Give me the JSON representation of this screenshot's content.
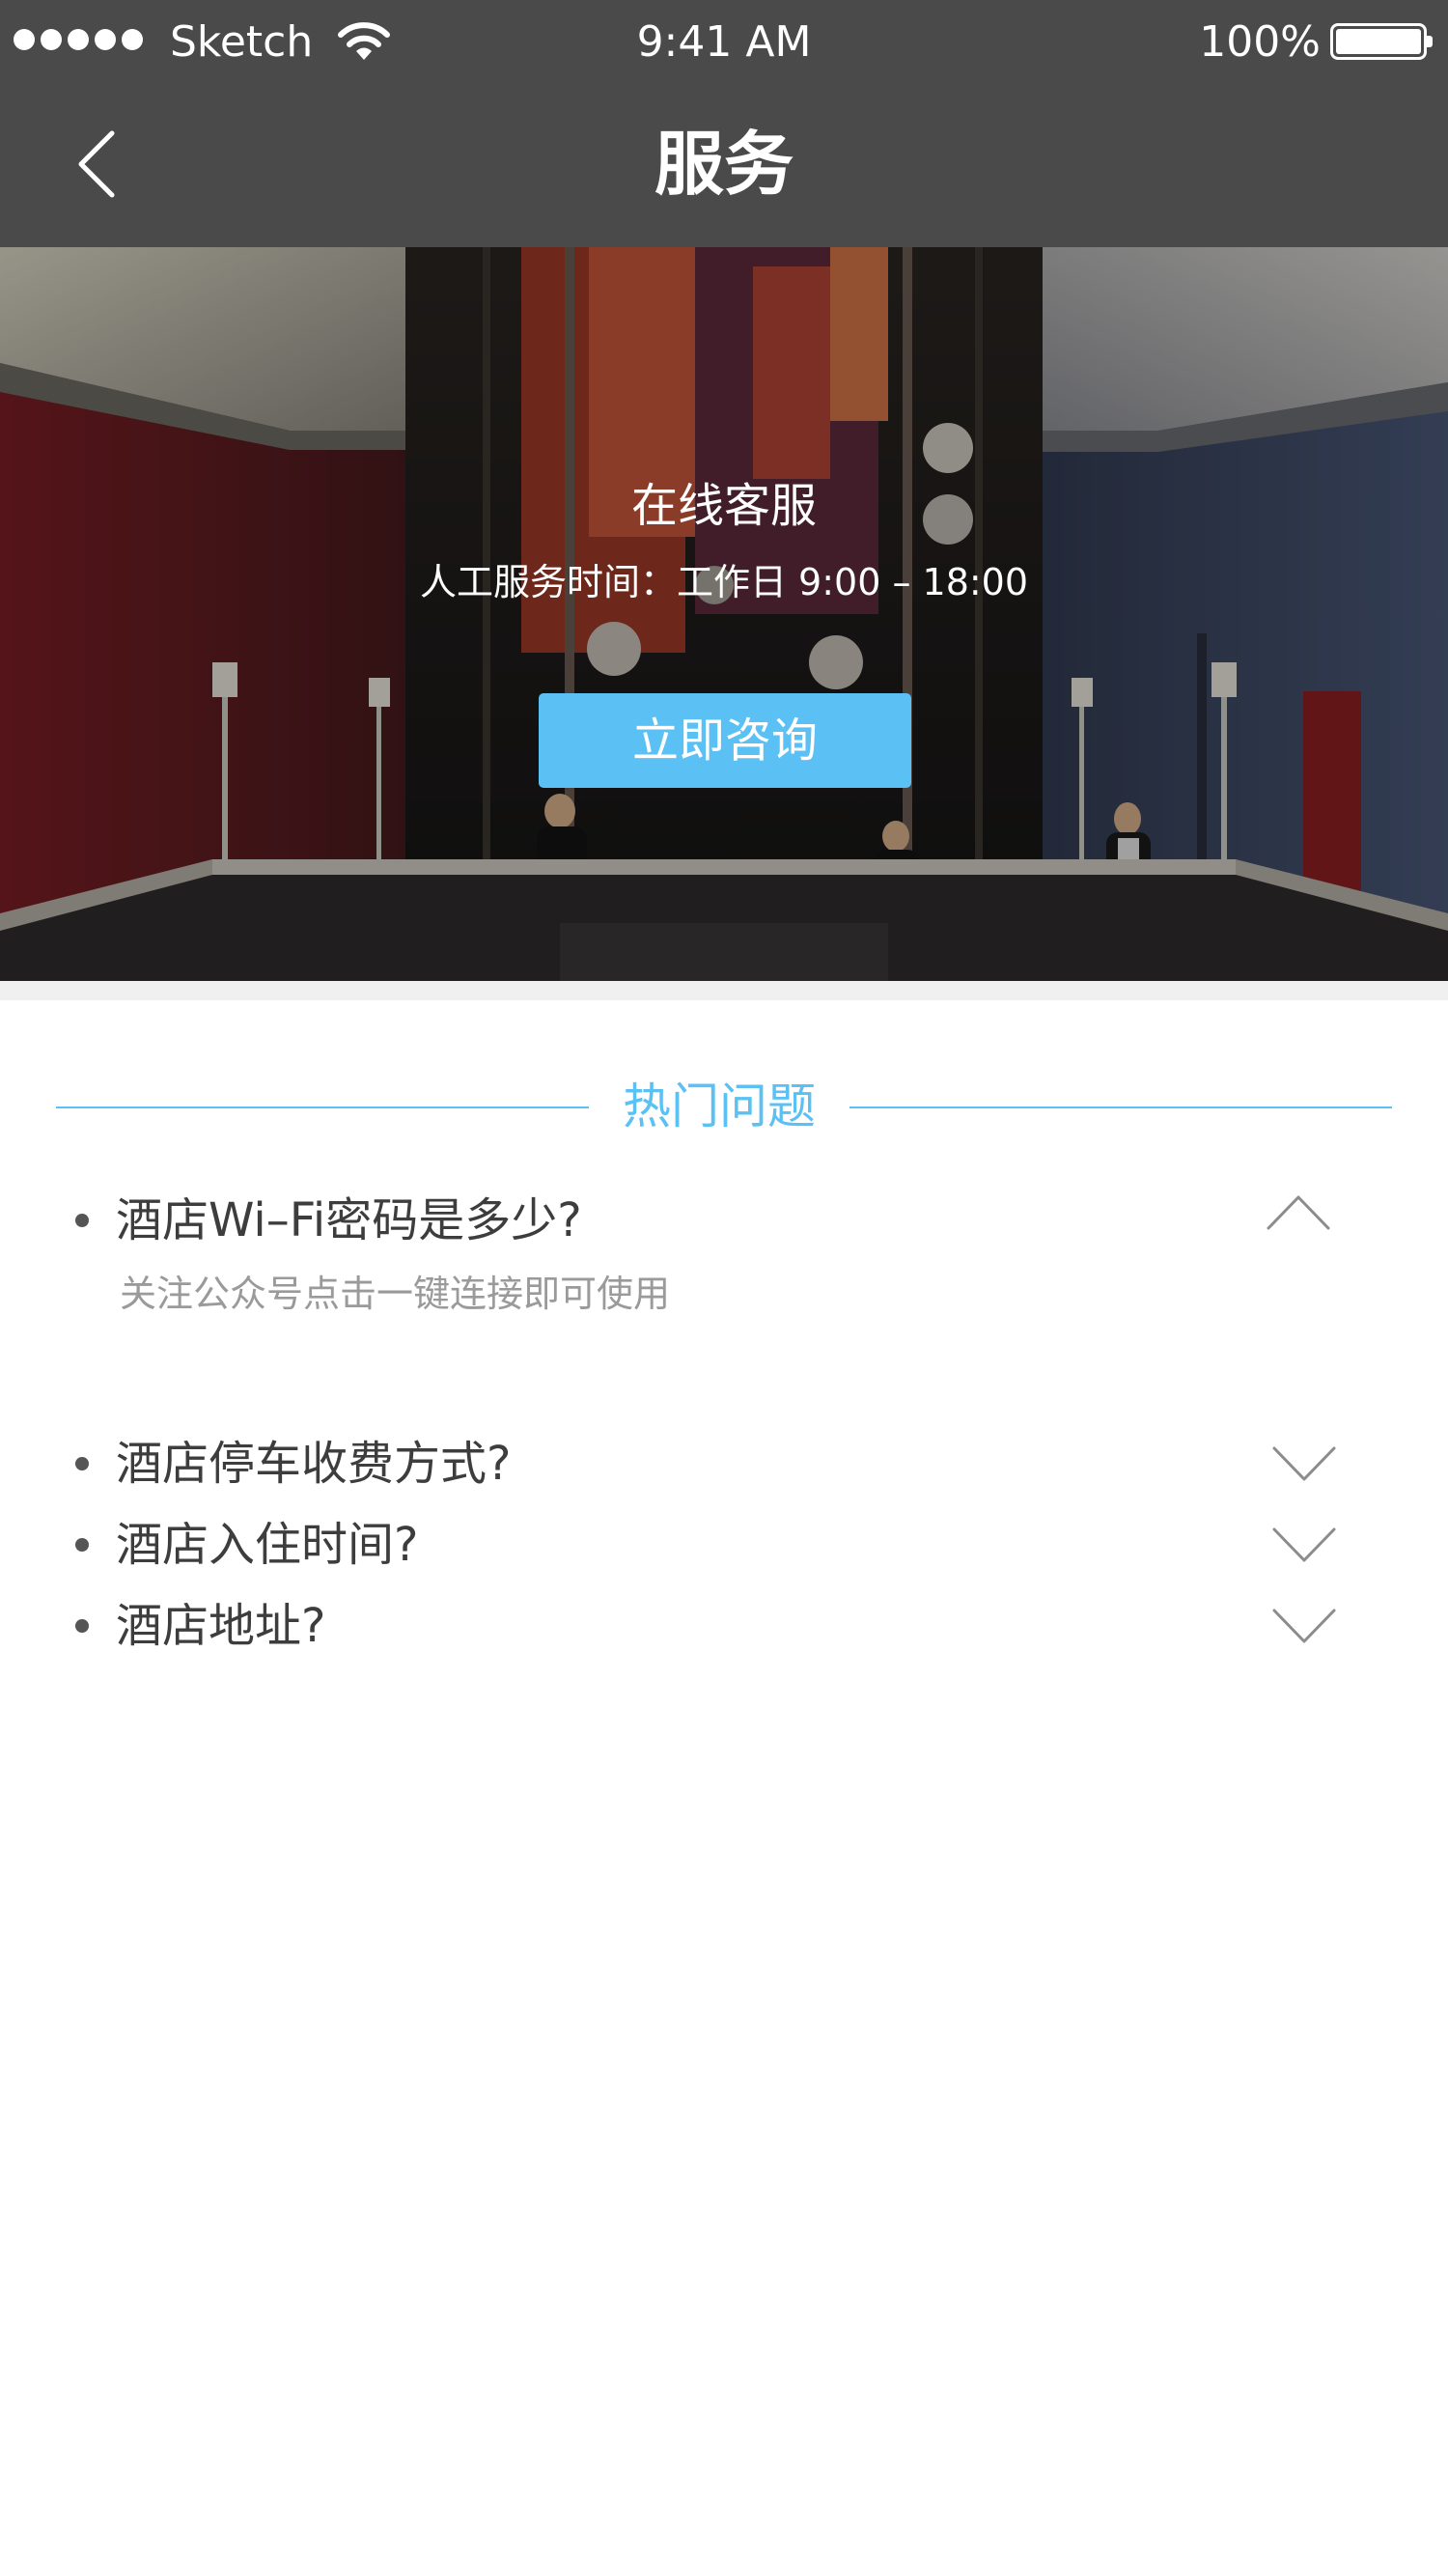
{
  "status_bar": {
    "carrier": "Sketch",
    "time": "9:41 AM",
    "battery_percent": "100%",
    "battery_level": 1.0,
    "signal_bars": 5,
    "icons": [
      "signal-dots-icon",
      "wifi-icon",
      "battery-icon"
    ]
  },
  "nav": {
    "title": "服务",
    "back_icon": "chevron-left-icon"
  },
  "hero": {
    "title": "在线客服",
    "hours": "人工服务时间：工作日 9:00 – 18:00",
    "consult_label": "立即咨询",
    "accent_color": "#5bc0f3"
  },
  "faq": {
    "section_title": "热门问题",
    "items": [
      {
        "question": "酒店Wi–Fi密码是多少?",
        "answer": "关注公众号点击一键连接即可使用",
        "expanded": true,
        "icon": "chevron-up-icon"
      },
      {
        "question": "酒店停车收费方式?",
        "expanded": false,
        "icon": "chevron-down-icon"
      },
      {
        "question": "酒店入住时间?",
        "expanded": false,
        "icon": "chevron-down-icon"
      },
      {
        "question": "酒店地址?",
        "expanded": false,
        "icon": "chevron-down-icon"
      }
    ]
  },
  "colors": {
    "topbar": "#4a4a4a",
    "accent": "#5bc0f3",
    "question_text": "#3d3d3d",
    "answer_text": "#9a9a9a"
  }
}
